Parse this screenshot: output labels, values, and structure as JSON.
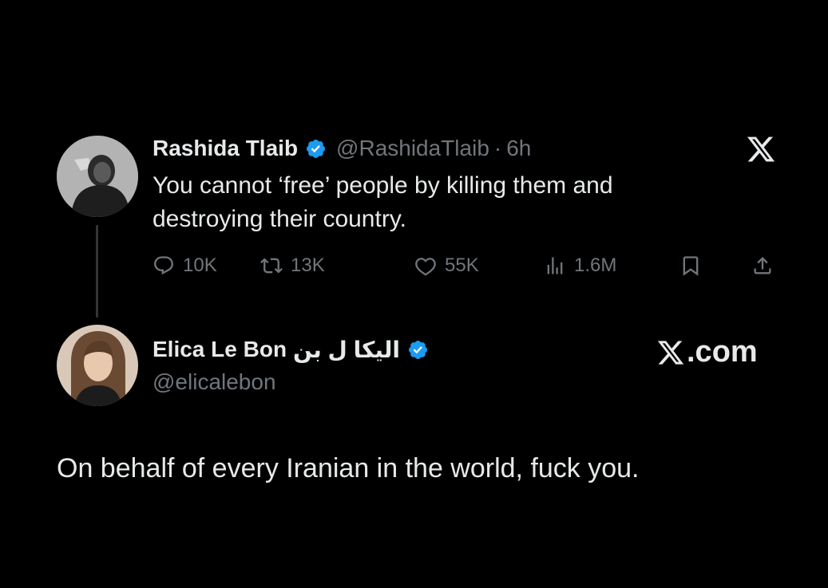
{
  "original_post": {
    "author_name": "Rashida Tlaib",
    "author_handle": "@RashidaTlaib",
    "separator": "·",
    "time": "6h",
    "text_lines": [
      "You cannot ‘free’ people by killing them and",
      "destroying their country."
    ],
    "stats": {
      "replies": "10K",
      "reposts": "13K",
      "likes": "55K",
      "views": "1.6M"
    }
  },
  "reply_post": {
    "author_name": "Elica Le Bon",
    "author_name_arabic": "الیکا ل بن",
    "author_handle": "@elicalebon",
    "text": "On behalf of every Iranian in the world, fuck you."
  },
  "branding": {
    "site_label": ".com"
  },
  "colors": {
    "background": "#000000",
    "primary_text": "#e7e9ea",
    "secondary_text": "#71767b",
    "verified_badge": "#1d9bf0",
    "thread_line": "#333639"
  },
  "icons": {
    "reply": "reply-icon",
    "repost": "repost-icon",
    "like": "heart-icon",
    "views": "views-icon",
    "bookmark": "bookmark-icon",
    "share": "share-icon",
    "verified": "verified-badge-icon",
    "x_logo": "x-logo-icon"
  }
}
